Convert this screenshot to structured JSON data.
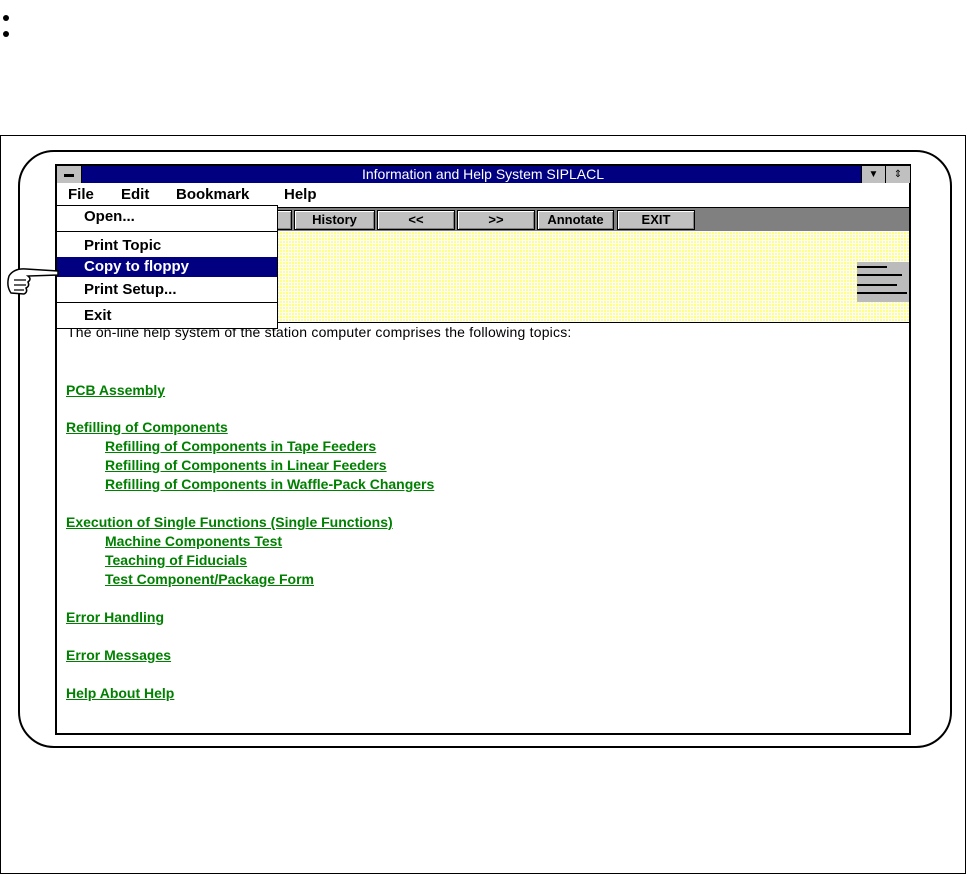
{
  "window": {
    "title": "Information and Help System SIPLACL"
  },
  "menubar": [
    "File",
    "Edit",
    "Bookmark",
    "Help"
  ],
  "toolbar": [
    "History",
    "<<",
    ">>",
    "Annotate",
    "EXIT"
  ],
  "file_menu": {
    "items": [
      "Open...",
      "Print Topic",
      "Copy to floppy",
      "Print Setup...",
      "Exit"
    ],
    "selected": "Copy to floppy"
  },
  "content": {
    "intro": "The on-line help system of the station computer comprises the following topics:",
    "topics": [
      {
        "label": "PCB Assembly",
        "level": 0
      },
      {
        "label": "Refilling of Components",
        "level": 0
      },
      {
        "label": "Refilling of Components in Tape Feeders",
        "level": 1
      },
      {
        "label": "Refilling of Components in Linear Feeders",
        "level": 1
      },
      {
        "label": "Refilling of Components in Waffle-Pack Changers",
        "level": 1
      },
      {
        "label": "Execution of Single Functions (Single Functions)",
        "level": 0
      },
      {
        "label": "Machine Components Test",
        "level": 1
      },
      {
        "label": "Teaching of Fiducials",
        "level": 1
      },
      {
        "label": "Test Component/Package Form",
        "level": 1
      },
      {
        "label": "Error Handling",
        "level": 0
      },
      {
        "label": "Error Messages",
        "level": 0
      },
      {
        "label": "Help About Help",
        "level": 0
      }
    ]
  },
  "colors": {
    "title": "#000080",
    "link": "#008000",
    "banner": "#ffff80"
  }
}
